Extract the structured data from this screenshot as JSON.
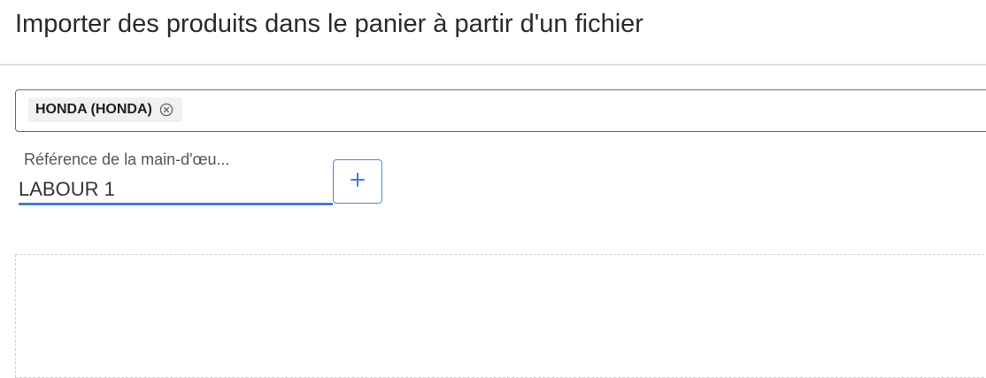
{
  "page": {
    "title": "Importer des produits dans le panier à partir d'un fichier"
  },
  "brand_selector": {
    "chips": [
      {
        "label": "HONDA (HONDA)",
        "remove_icon": "close-circle-icon"
      }
    ]
  },
  "labour_reference": {
    "label": "Référence de la main-d'œu...",
    "value": "LABOUR 1"
  },
  "add_button": {
    "icon": "plus-icon"
  },
  "colors": {
    "accent": "#3b7fd0",
    "button_border": "#4a86d6",
    "title_text": "#2a2a2a",
    "chip_background": "#f1f1f1"
  }
}
